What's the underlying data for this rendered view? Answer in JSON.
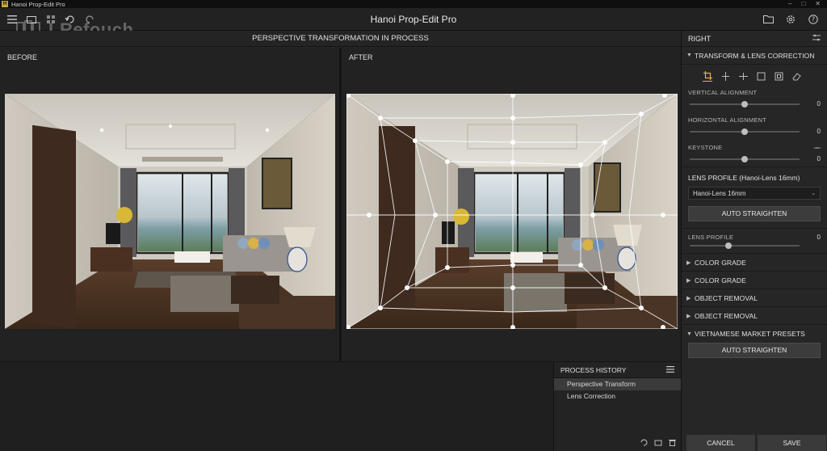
{
  "os_bar": {
    "title": "Hanoi Prop-Edit Pro"
  },
  "app": {
    "title": "Hanoi Prop-Edit Pro",
    "watermark": "LRefouch"
  },
  "workspace": {
    "title": "PERSPECTIVE TRANSFORMATION IN PROCESS",
    "before_label": "BEFORE",
    "after_label": "AFTER"
  },
  "history": {
    "title": "PROCESS HISTORY",
    "items": [
      "Perspective Transform",
      "Lens Correction"
    ]
  },
  "right_panel": {
    "title": "RIGHT",
    "section_transform": "TRANSFORM & LENS CORRECTION",
    "sliders": [
      {
        "label": "VERTICAL ALIGNMENT",
        "value": "0",
        "position": 0.5
      },
      {
        "label": "HORIZONTAL ALIGNMENT",
        "value": "0",
        "position": 0.5
      },
      {
        "label": "KEYSTONE",
        "value": "0",
        "position": 0.5
      }
    ],
    "lens_profile_title": "LENS PROFILE (Hanoi-Lens 16mm)",
    "lens_select": "Hanoi-Lens 16mm",
    "auto_straighten": "AUTO STRAIGHTEN",
    "lens_profile_slider": {
      "label": "LENS PROFILE",
      "value": "0",
      "position": 0.35
    },
    "collapsed_sections": [
      "COLOR GRADE",
      "COLOR GRADE",
      "OBJECT REMOVAL",
      "OBJECT REMOVAL"
    ],
    "vietnamese_section": "VIETNAMESE MARKET PRESETS",
    "auto_straighten_2": "AUTO STRAIGHTEN",
    "cancel": "CANCEL",
    "save": "SAVE"
  },
  "colors": {
    "accent": "#d8b34c",
    "panel": "#262626",
    "button": "#3c3c3c"
  }
}
